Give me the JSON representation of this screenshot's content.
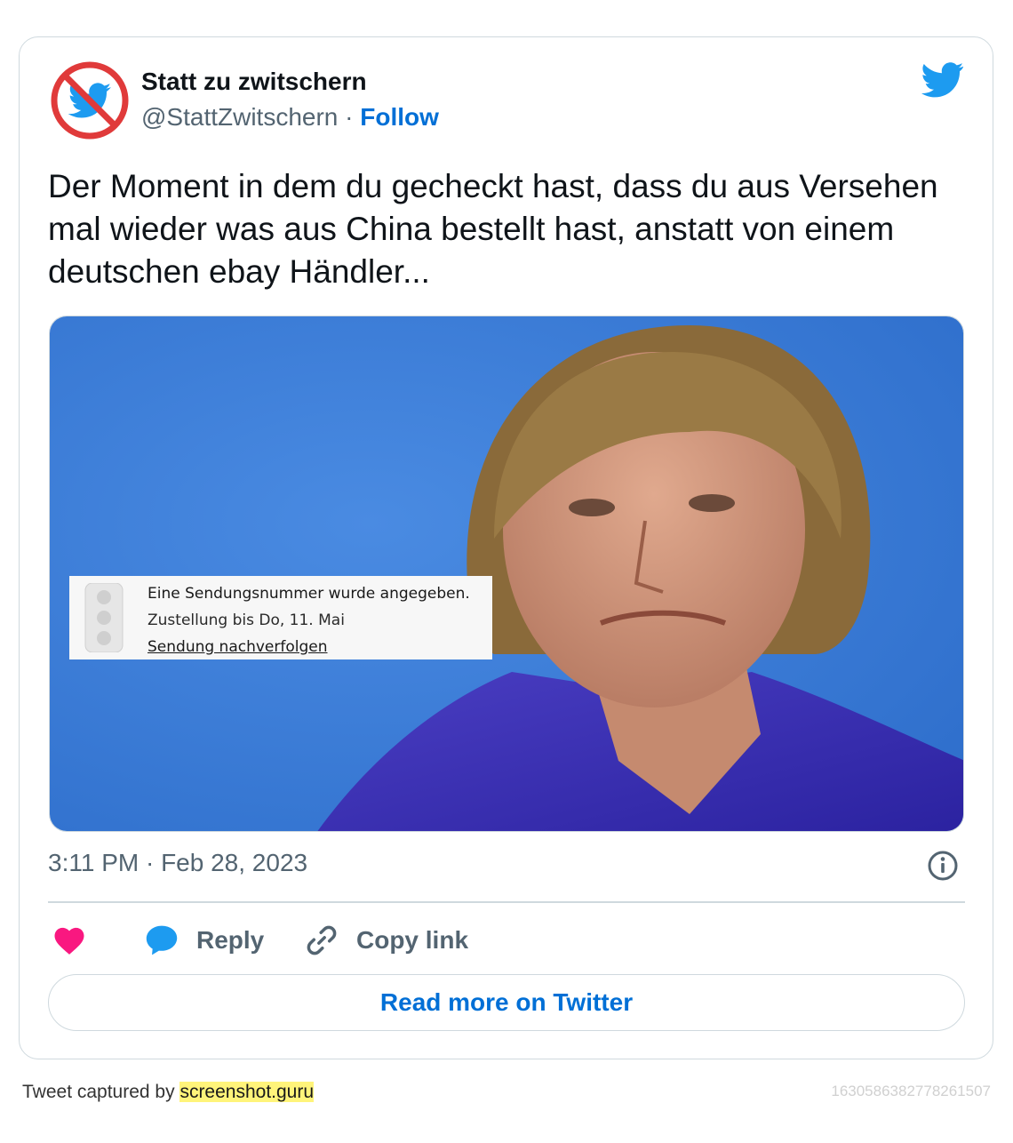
{
  "author": {
    "name": "Statt zu zwitschern",
    "handle": "@StattZwitschern",
    "separator": "·",
    "follow_label": "Follow"
  },
  "tweet": {
    "text": "Der Moment in dem du gecheckt hast, dass du aus Versehen mal wieder was aus China bestellt hast, anstatt von einem deutschen ebay Händler...",
    "timestamp": "3:11 PM · Feb 28, 2023"
  },
  "media_overlay": {
    "line1": "Eine Sendungsnummer wurde angegeben.",
    "line2": "Zustellung bis Do, 11. Mai",
    "line3": "Sendung nachverfolgen"
  },
  "actions": {
    "like_icon": "heart-icon",
    "reply_label": "Reply",
    "copy_label": "Copy link"
  },
  "read_more_label": "Read more on Twitter",
  "footer": {
    "prefix": "Tweet captured by ",
    "link": "screenshot.guru",
    "tweet_id": "1630586382778261507"
  },
  "colors": {
    "accent": "#006fd6",
    "twitter_blue": "#1d9bf0",
    "like": "#f91880",
    "muted": "#536471",
    "media_bg": "#3d7dd8"
  }
}
